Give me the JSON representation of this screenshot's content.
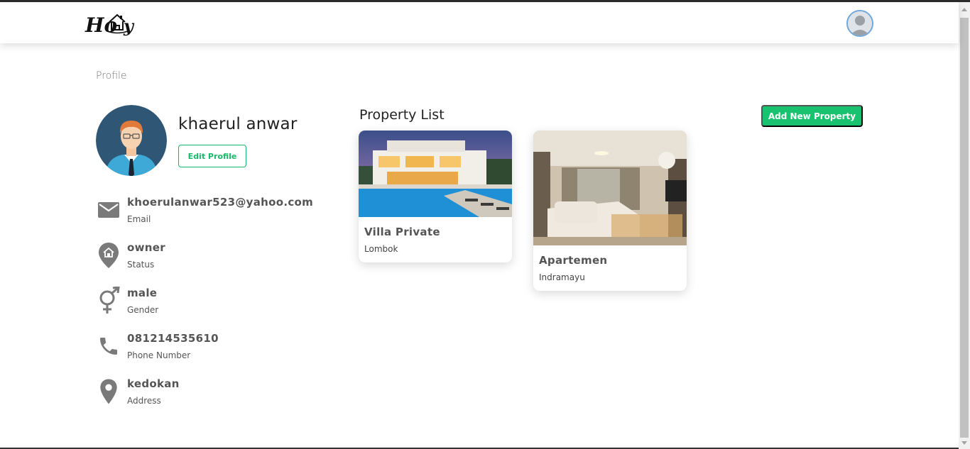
{
  "brand": {
    "logo_text": "Homy"
  },
  "breadcrumb": "Profile",
  "profile": {
    "name": "khaerul anwar",
    "edit_label": "Edit Profile",
    "fields": [
      {
        "icon": "mail-icon",
        "value": "khoerulanwar523@yahoo.com",
        "label": "Email"
      },
      {
        "icon": "home-pin-icon",
        "value": "owner",
        "label": "Status"
      },
      {
        "icon": "gender-icon",
        "value": "male",
        "label": "Gender"
      },
      {
        "icon": "phone-icon",
        "value": "081214535610",
        "label": "Phone Number"
      },
      {
        "icon": "location-pin-icon",
        "value": "kedokan",
        "label": "Address"
      }
    ]
  },
  "properties": {
    "title": "Property List",
    "add_label": "Add New Property",
    "items": [
      {
        "name": "Villa Private",
        "location": "Lombok"
      },
      {
        "name": "Apartemen",
        "location": "Indramayu"
      }
    ]
  },
  "colors": {
    "accent": "#19c26e",
    "accent_outline": "#19b96a",
    "icon_gray": "#7a7a7a"
  }
}
